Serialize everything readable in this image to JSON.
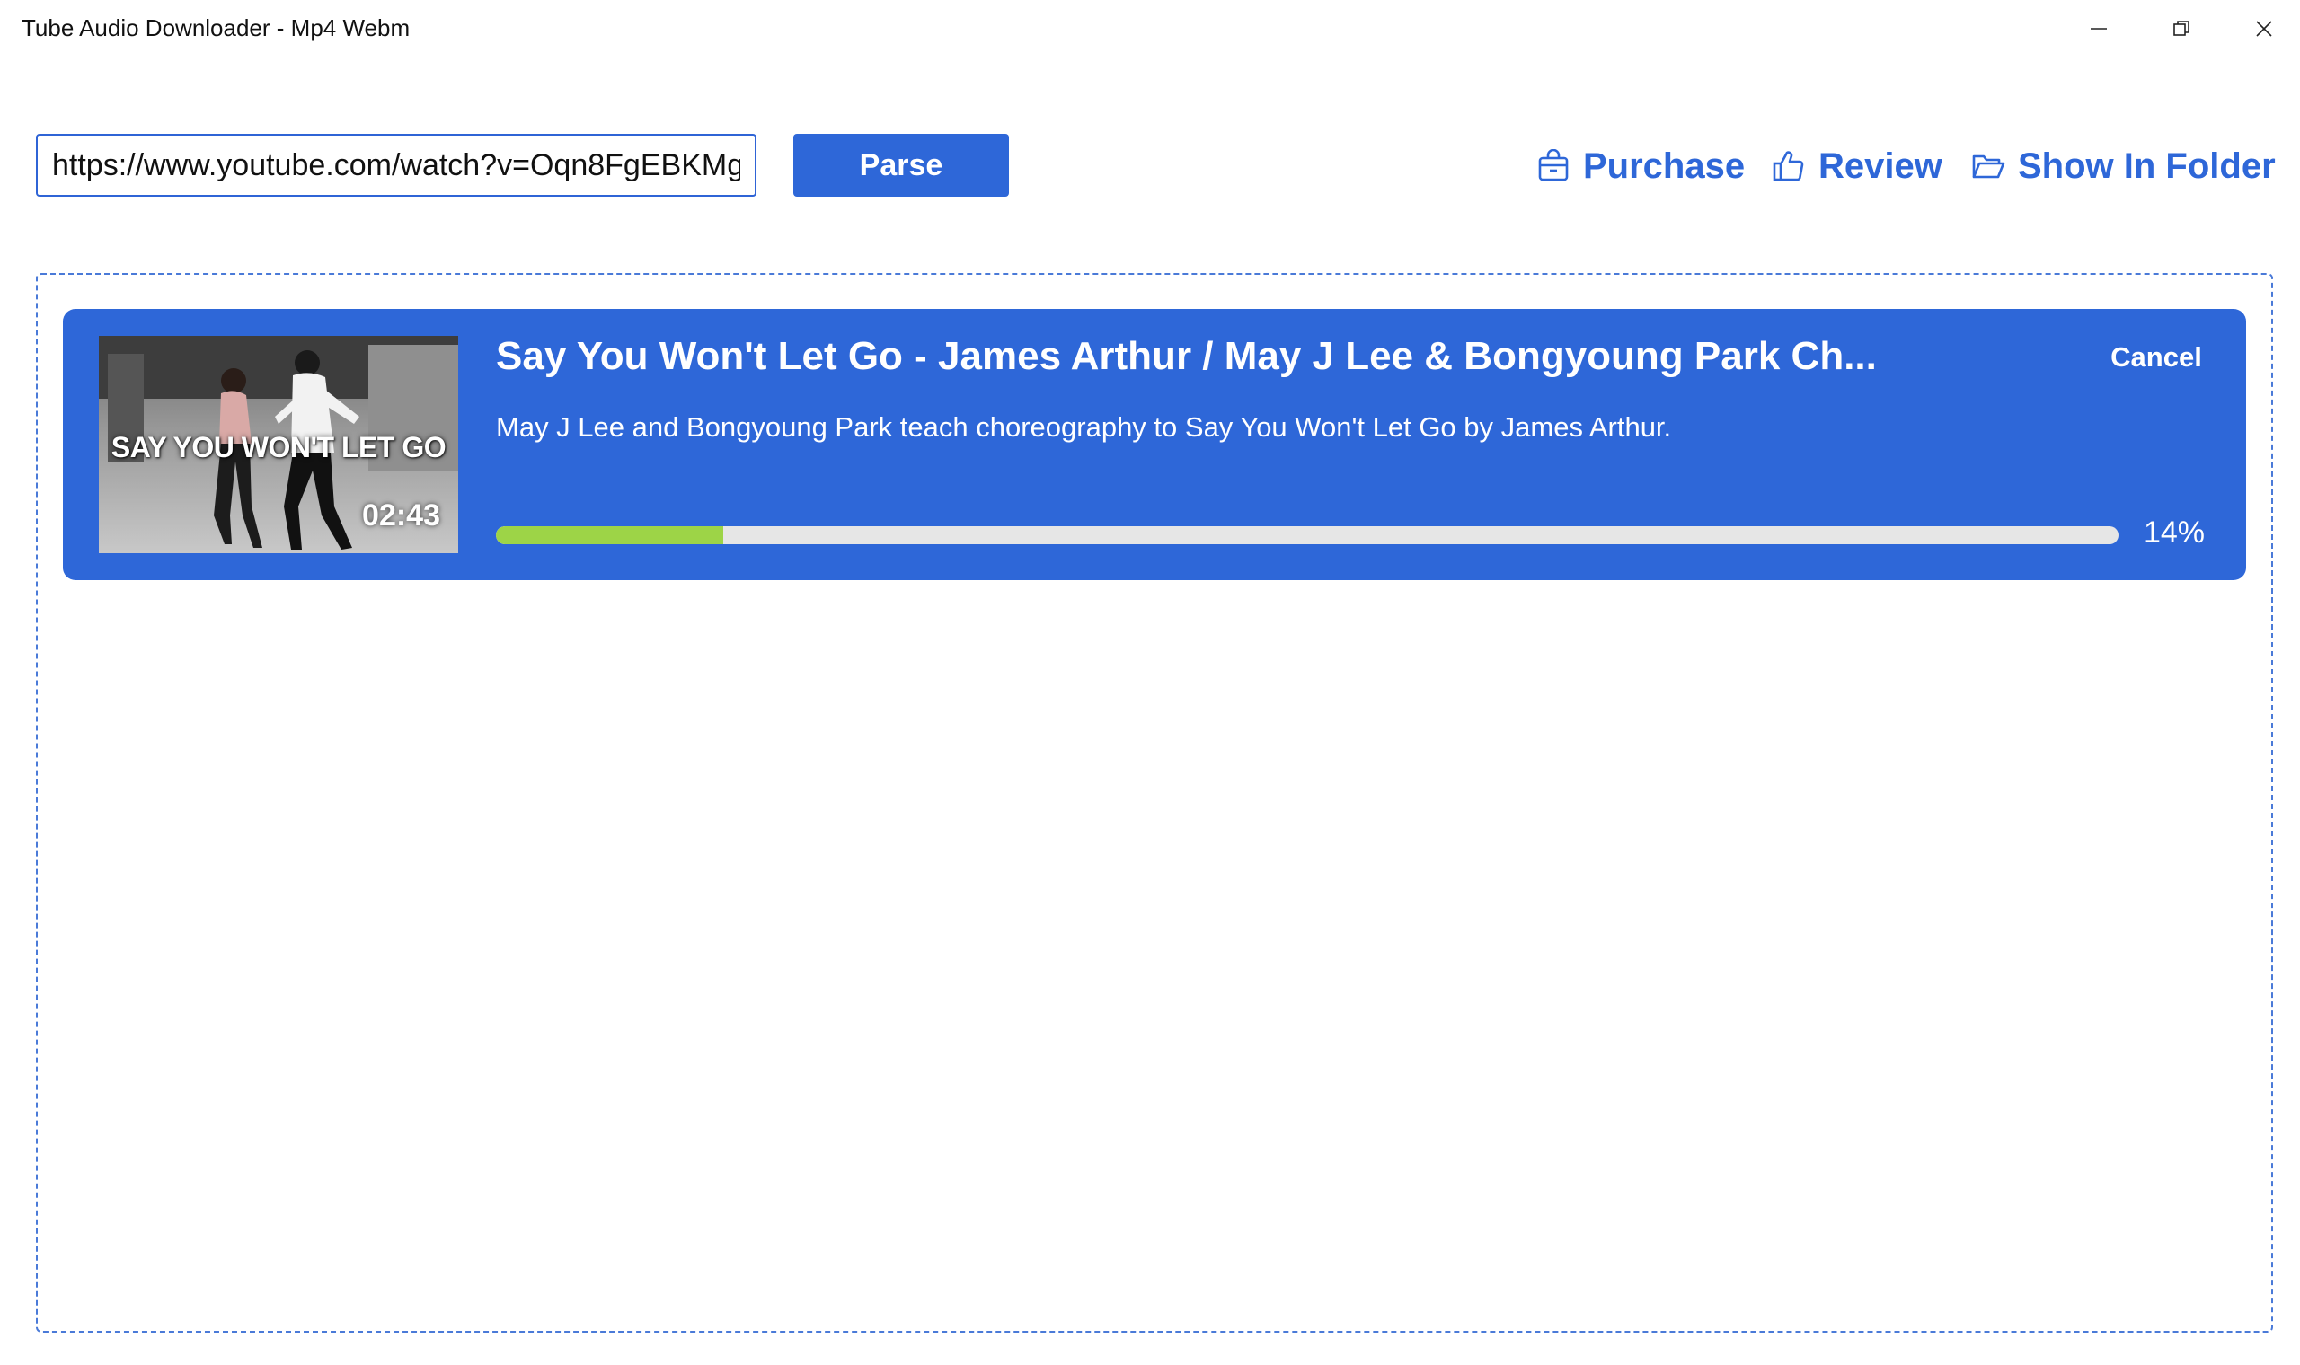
{
  "window": {
    "title": "Tube Audio Downloader - Mp4 Webm",
    "controls": [
      "minimize-icon",
      "restore-icon",
      "close-icon"
    ]
  },
  "toolbar": {
    "url_value": "https://www.youtube.com/watch?v=Oqn8FgEBKMg",
    "parse_label": "Parse",
    "links": {
      "purchase": {
        "label": "Purchase",
        "icon": "shopping-bag-icon"
      },
      "review": {
        "label": "Review",
        "icon": "thumbs-up-icon"
      },
      "show_in_folder": {
        "label": "Show In Folder",
        "icon": "folder-icon"
      }
    }
  },
  "download": {
    "title": "Say You Won't Let Go - James Arthur / May J Lee & Bongyoung Park Ch...",
    "description": "May J Lee and Bongyoung Park teach choreography to Say You Won't Let Go by James Arthur.",
    "thumbnail": {
      "caption": "SAY YOU WON'T LET GO",
      "duration": "02:43"
    },
    "cancel_label": "Cancel",
    "progress_percent": 14,
    "progress_label": "14%"
  },
  "colors": {
    "accent": "#2e67d8",
    "progress_fill": "#9dd447",
    "progress_track": "#e6e6e6",
    "background": "#ffffff"
  }
}
